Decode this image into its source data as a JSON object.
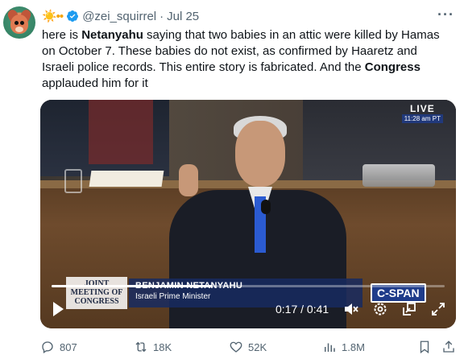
{
  "author": {
    "emoji": "☀️••",
    "handle": "@zei_squirrel",
    "separator": "·",
    "date": "Jul 25"
  },
  "tweet": {
    "segments": [
      {
        "text": "here is ",
        "bold": false
      },
      {
        "text": "Netanyahu",
        "bold": true
      },
      {
        "text": " saying that two babies in an attic were killed by Hamas on October 7. These babies do not exist, as confirmed by Haaretz and Israeli police records. This entire story is fabricated. And the ",
        "bold": false
      },
      {
        "text": "Congress",
        "bold": true
      },
      {
        "text": " applauded him for it",
        "bold": false
      }
    ]
  },
  "video": {
    "live_label": "LIVE",
    "live_time": "11:28 am PT",
    "joint_meeting": "JOINT MEETING OF CONGRESS",
    "chyron_name": "BENJAMIN NETANYAHU",
    "chyron_title": "Israeli Prime Minister",
    "network": "C-SPAN",
    "timecode": "0:17 / 0:41",
    "progress": 0.41
  },
  "actions": {
    "replies": "807",
    "reposts": "18K",
    "likes": "52K",
    "views": "1.8M"
  },
  "colors": {
    "text": "#0f1419",
    "muted": "#536471",
    "verified": "#1d9bf0"
  }
}
